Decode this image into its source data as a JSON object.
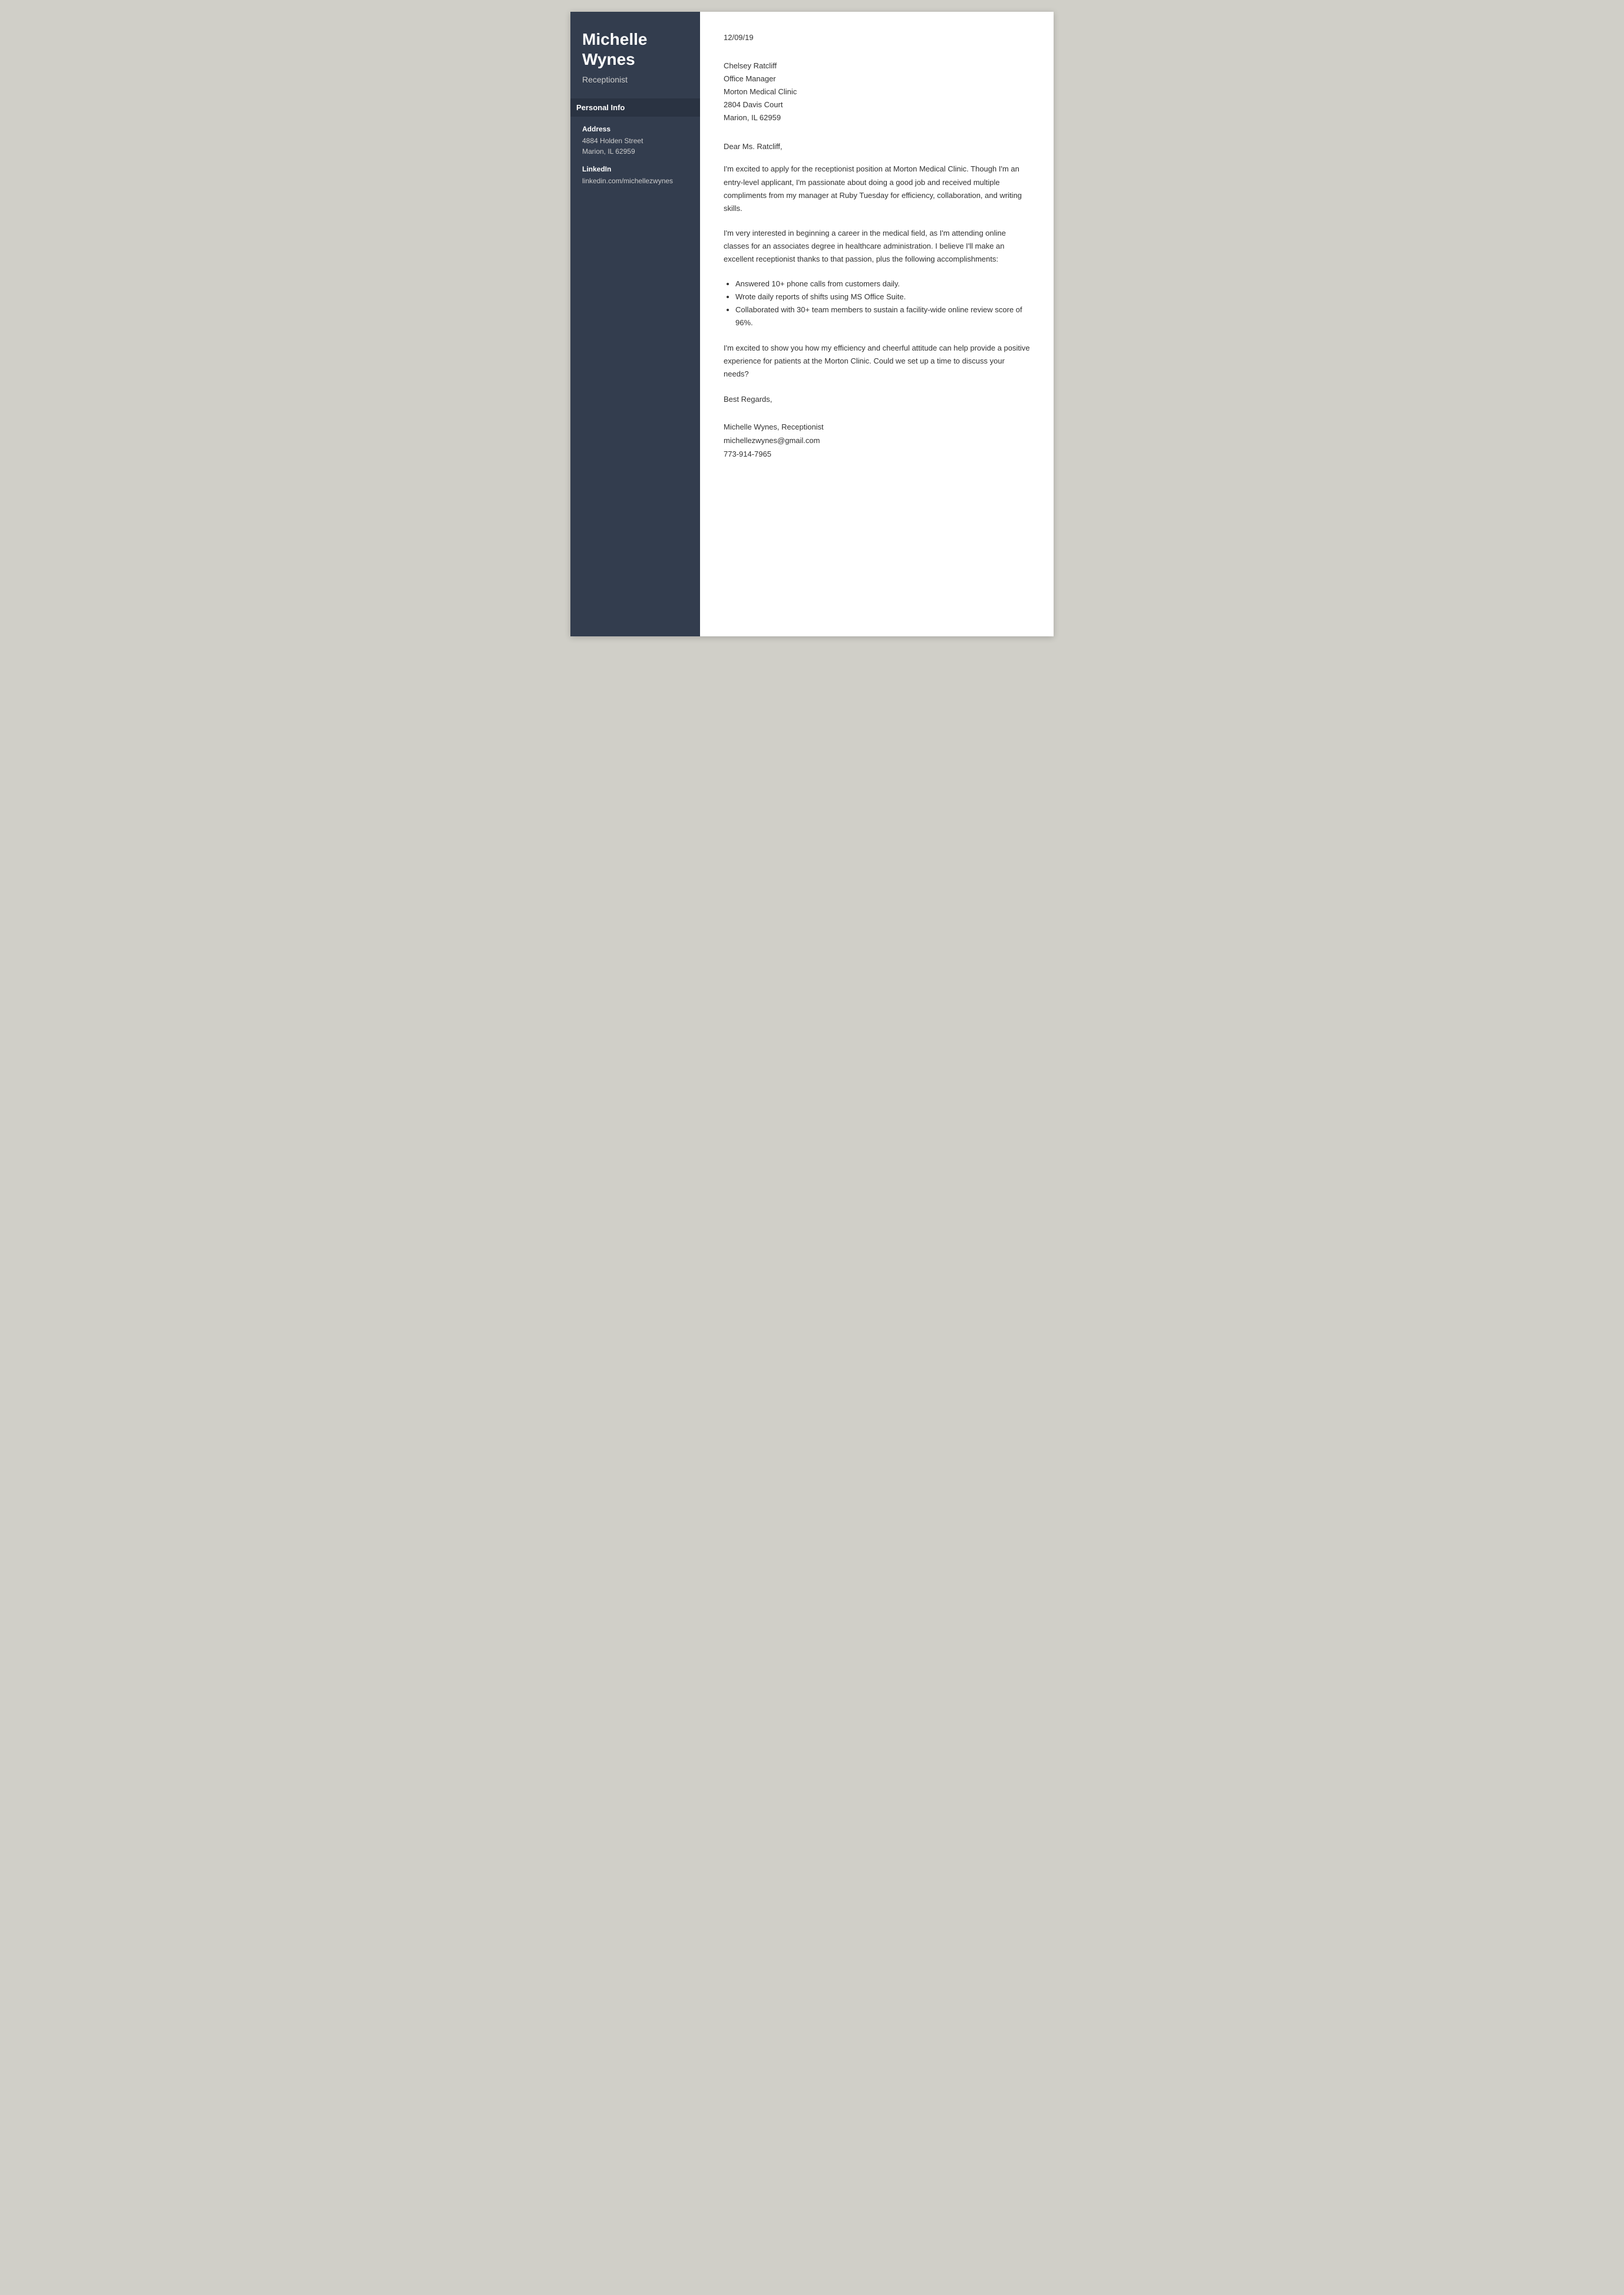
{
  "sidebar": {
    "name": "Michelle Wynes",
    "title": "Receptionist",
    "personal_info_label": "Personal Info",
    "address_label": "Address",
    "address_line1": "4884 Holden Street",
    "address_line2": "Marion, IL 62959",
    "linkedin_label": "LinkedIn",
    "linkedin_value": "linkedin.com/michellezwynes"
  },
  "main": {
    "date": "12/09/19",
    "recipient_name": "Chelsey Ratcliff",
    "recipient_title": "Office Manager",
    "recipient_company": "Morton Medical Clinic",
    "recipient_address1": "2804 Davis Court",
    "recipient_address2": "Marion, IL 62959",
    "salutation": "Dear Ms. Ratcliff,",
    "paragraph1": "I'm excited to apply for the receptionist position at Morton Medical Clinic. Though I'm an entry-level applicant, I'm passionate about doing a good job and received multiple compliments from my manager at Ruby Tuesday for efficiency, collaboration, and writing skills.",
    "paragraph2": "I'm very interested in beginning a career in the medical field, as I'm attending online classes for an associates degree in healthcare administration. I believe I'll make an excellent receptionist thanks to that passion, plus the following accomplishments:",
    "bullet1": "Answered 10+ phone calls from customers daily.",
    "bullet2": "Wrote daily reports of shifts using MS Office Suite.",
    "bullet3": "Collaborated with 30+ team members to sustain a facility-wide online review score of 96%.",
    "paragraph3": "I'm excited to show you how my efficiency and cheerful attitude can help provide a positive experience for patients at the Morton Clinic. Could we set up a time to discuss your needs?",
    "closing": "Best Regards,",
    "signature_name": "Michelle Wynes, Receptionist",
    "signature_email": "michellezwynes@gmail.com",
    "signature_phone": "773-914-7965"
  }
}
